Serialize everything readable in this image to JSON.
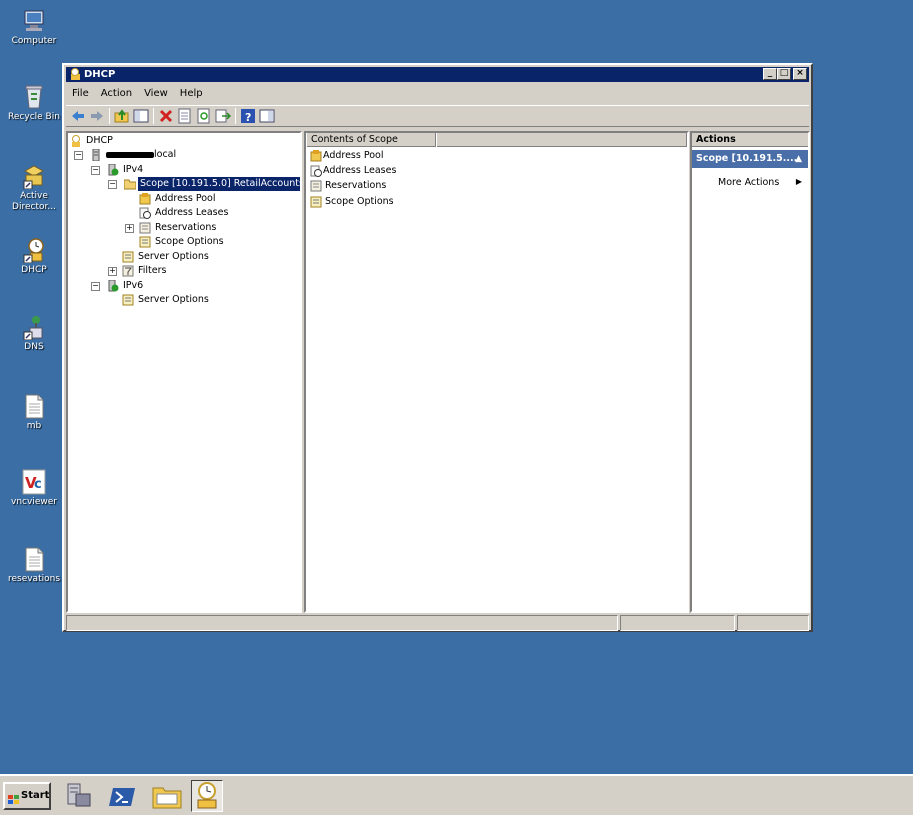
{
  "desktop": {
    "icons": [
      {
        "label": "Computer",
        "icon": "computer-icon"
      },
      {
        "label": "Recycle Bin",
        "icon": "recycle-bin-icon"
      },
      {
        "label": "Active Director...",
        "icon": "active-directory-icon"
      },
      {
        "label": "DHCP",
        "icon": "dhcp-icon"
      },
      {
        "label": "DNS",
        "icon": "dns-icon"
      },
      {
        "label": "mb",
        "icon": "document-icon"
      },
      {
        "label": "vncviewer",
        "icon": "vnc-icon"
      },
      {
        "label": "resevations",
        "icon": "document-icon"
      }
    ]
  },
  "window": {
    "title": "DHCP",
    "menu": [
      "File",
      "Action",
      "View",
      "Help"
    ],
    "tree": {
      "root": "DHCP",
      "server": "local",
      "ipv4": "IPv4",
      "scope": "Scope [10.191.5.0] RetailAccounts",
      "scope_children": [
        "Address Pool",
        "Address Leases",
        "Reservations",
        "Scope Options"
      ],
      "server_options": "Server Options",
      "filters": "Filters",
      "ipv6": "IPv6",
      "ipv6_server_options": "Server Options"
    },
    "contents": {
      "header": "Contents of Scope",
      "items": [
        "Address Pool",
        "Address Leases",
        "Reservations",
        "Scope Options"
      ]
    },
    "actions": {
      "header": "Actions",
      "scope": "Scope [10.191.5....",
      "more": "More Actions"
    }
  },
  "taskbar": {
    "start": "Start"
  },
  "colors": {
    "desktop": "#3a6ea5",
    "titlebar": "#0a246a",
    "selection": "#0a246a",
    "actions_band": "#4a6ea8"
  }
}
